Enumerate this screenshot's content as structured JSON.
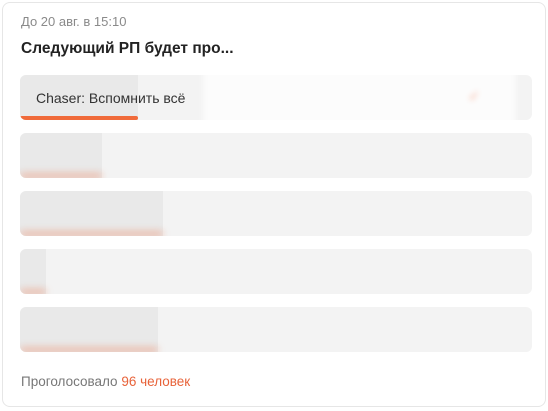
{
  "poll": {
    "deadline": "До 20 авг. в 15:10",
    "title": "Следующий РП будет про...",
    "accent_color": "#f06a3a",
    "options": [
      {
        "label": "Chaser: Вспомнить всё",
        "fill": 0.23,
        "blurred": false,
        "selected": true
      },
      {
        "label": "",
        "fill": 0.16,
        "blurred": true
      },
      {
        "label": "",
        "fill": 0.28,
        "blurred": true
      },
      {
        "label": "",
        "fill": 0.05,
        "blurred": true
      },
      {
        "label": "",
        "fill": 0.27,
        "blurred": true
      }
    ],
    "footer": {
      "prefix": "Проголосовало",
      "votes": "96 человек"
    }
  }
}
